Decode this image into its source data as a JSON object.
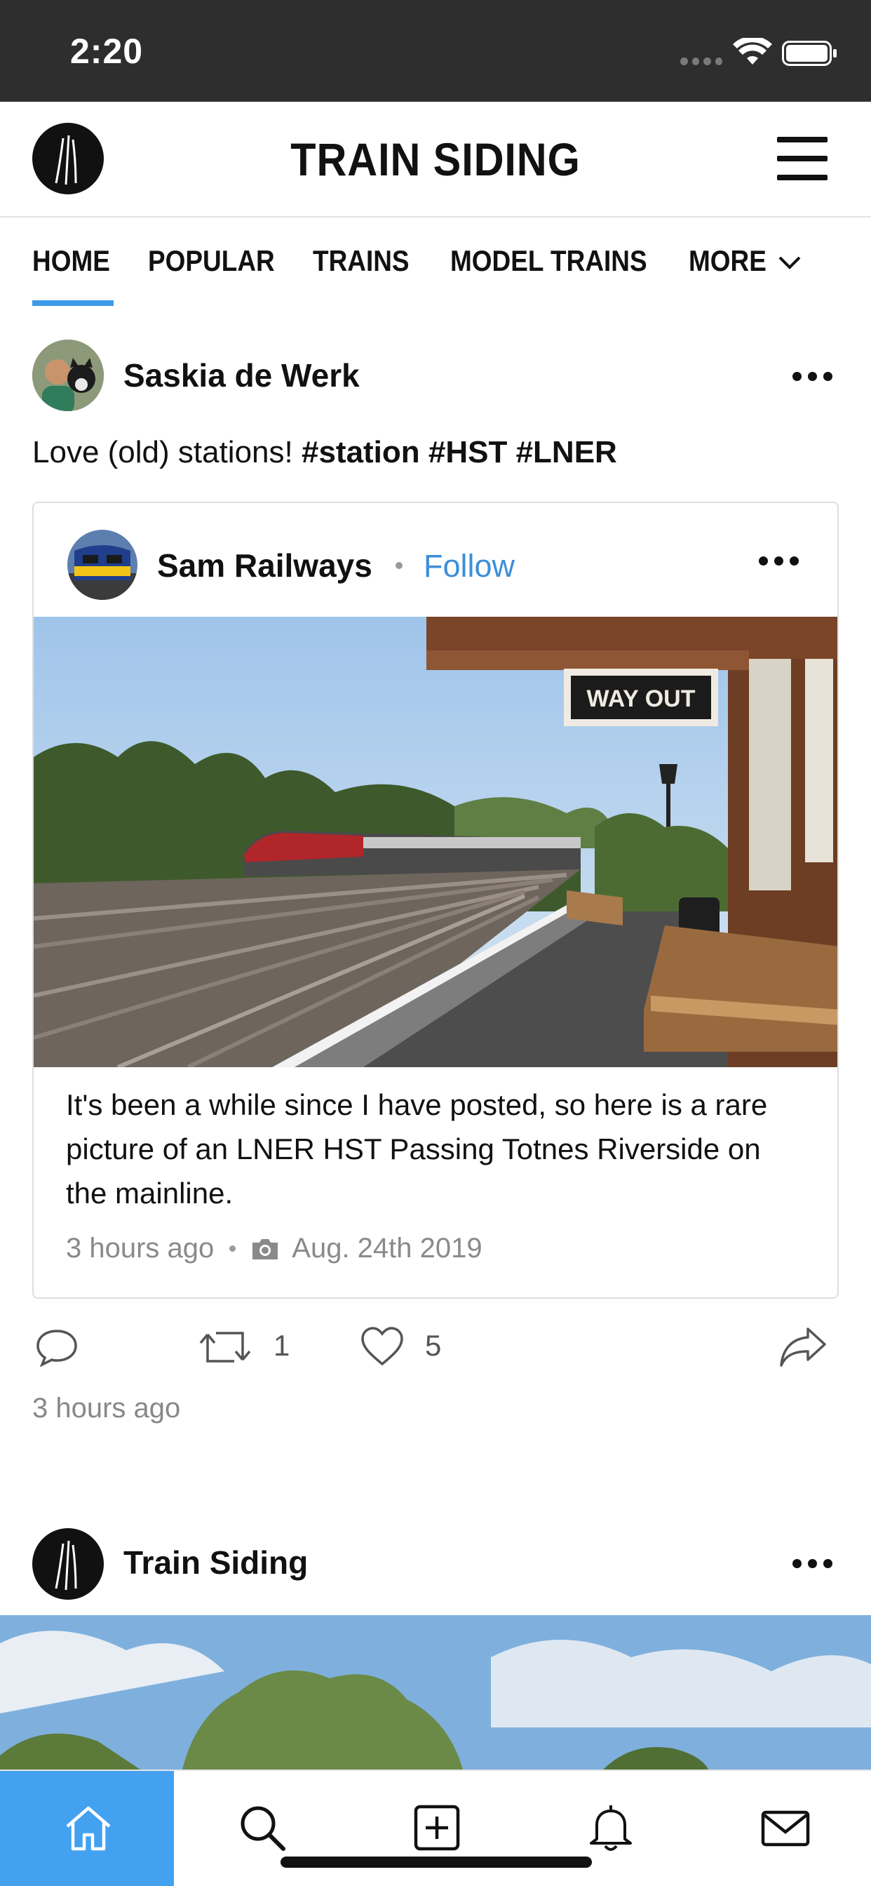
{
  "status_bar": {
    "time": "2:20",
    "icons": [
      "signal-dots-icon",
      "wifi-icon",
      "battery-icon"
    ]
  },
  "header": {
    "title": "TRAIN SIDING",
    "logo": "train-siding-logo",
    "menu_icon": "hamburger-menu-icon"
  },
  "tabs": {
    "items": [
      {
        "label": "HOME",
        "active": true
      },
      {
        "label": "POPULAR"
      },
      {
        "label": "TRAINS"
      },
      {
        "label": "MODEL TRAINS"
      },
      {
        "label": "MORE"
      }
    ],
    "more_icon": "chevron-down-icon"
  },
  "post": {
    "author": "Saskia de Werk",
    "text": "Love (old) stations! ",
    "hashtags": "#station #HST #LNER",
    "embed": {
      "author": "Sam Railways",
      "follow_label": "Follow",
      "caption": "It's been a while since I have posted, so here is a rare picture of an LNER HST Passing Totnes Riverside on the mainline.",
      "time": "3 hours ago",
      "photo_date": "Aug. 24th 2019",
      "sign_text": "WAY OUT"
    },
    "actions": {
      "repost_count": "1",
      "like_count": "5"
    },
    "time": "3 hours ago"
  },
  "second_post": {
    "author": "Train Siding"
  },
  "bottom_nav": {
    "items": [
      {
        "icon": "home-icon",
        "active": true
      },
      {
        "icon": "search-icon"
      },
      {
        "icon": "add-post-icon"
      },
      {
        "icon": "notifications-bell-icon"
      },
      {
        "icon": "messages-envelope-icon"
      }
    ]
  },
  "colors": {
    "accent": "#43a1f0",
    "link": "#3d8fd8",
    "status_bar": "#2e2e2e"
  }
}
